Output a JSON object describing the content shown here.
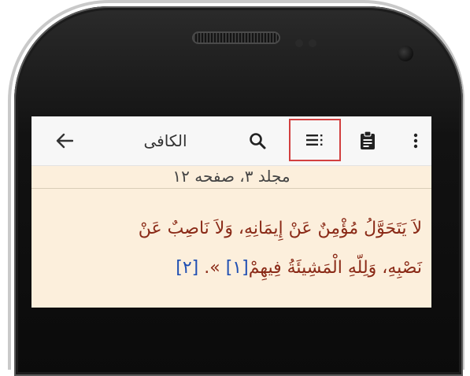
{
  "toolbar": {
    "title": "الكافى",
    "icons": [
      "back-arrow-icon",
      "search-icon",
      "toc-list-icon",
      "clipboard-icon",
      "more-vert-icon"
    ]
  },
  "page": {
    "subtitle": "مجلد ٣، صفحه ١٢"
  },
  "text": {
    "line1": "لاَ يَتَحَوَّلُ مُؤْمِنٌ عَنْ إِيمَانِهِ، وَلاَ نَاصِبٌ عَنْ",
    "line2_main": "نَصْبِهِ، وَلِلّهِ الْمَشِيئَةُ فِيهِمْ",
    "ref1": "[١]",
    "line2_mid": " ». ",
    "ref2": "[٢]"
  },
  "colors": {
    "screen_bg": "#fcefdc",
    "text": "#8a2a17",
    "reference": "#1f4fb3",
    "highlight_border": "#d23f3f"
  }
}
